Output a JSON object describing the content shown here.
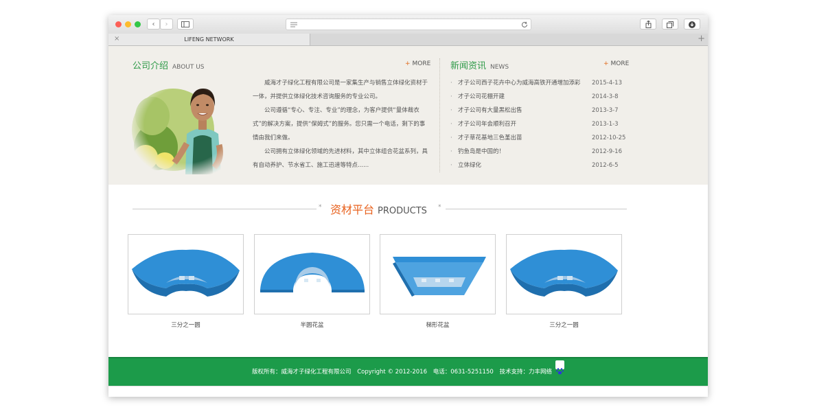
{
  "browser": {
    "tab_title": "LIFENG NETWORK",
    "tab_close": "×",
    "new_tab": "+",
    "nav_back": "‹",
    "nav_forward": "›"
  },
  "about": {
    "title": "公司介绍",
    "title_en": "ABOUT US",
    "more": "MORE",
    "paragraphs": [
      "威海才子绿化工程有限公司是一家集生产与销售立体绿化资材于一体，并提供立体绿化技术咨询服务的专业公司。",
      "公司遵循“专心、专注、专业”的理念，为客户提供“量体裁衣式”的解决方案，提供“保姆式”的服务。您只需一个电话，剩下的事情由我们来做。",
      "公司拥有立体绿化领域的先进材料，其中立体组合花盆系列，具有自动养护、节水省工、施工迅速等特点......"
    ]
  },
  "news": {
    "title": "新闻资讯",
    "title_en": "NEWS",
    "more": "MORE",
    "bullet": "·",
    "items": [
      {
        "title": "才子公司西子花卉中心为威海高铁开通增加添彩",
        "date": "2015-4-13"
      },
      {
        "title": "才子公司花棚开建",
        "date": "2014-3-8"
      },
      {
        "title": "才子公司有大量黑松出售",
        "date": "2013-3-7"
      },
      {
        "title": "才子公司年会顺利召开",
        "date": "2013-1-3"
      },
      {
        "title": "才子草花基地三色堇出苗",
        "date": "2012-10-25"
      },
      {
        "title": "钓鱼岛是中国的！",
        "date": "2012-9-16"
      },
      {
        "title": "立体绿化",
        "date": "2012-6-5"
      }
    ]
  },
  "products": {
    "title": "资材平台",
    "title_en": "PRODUCTS",
    "star": "*",
    "items": [
      {
        "name": "三分之一圆"
      },
      {
        "name": "半圆花盆"
      },
      {
        "name": "梯形花盆"
      },
      {
        "name": "三分之一圆"
      }
    ]
  },
  "footer": {
    "copyright_owner": "版权所有：威海才子绿化工程有限公司",
    "copyright": "Copyright © 2012-2016",
    "phone": "电话：0631-5251150",
    "support": "技术支持：力丰网络"
  },
  "colors": {
    "accent_green": "#1c9b4a",
    "title_green": "#2e9a48",
    "accent_orange": "#e8621e",
    "product_blue": "#2f8fd6"
  }
}
